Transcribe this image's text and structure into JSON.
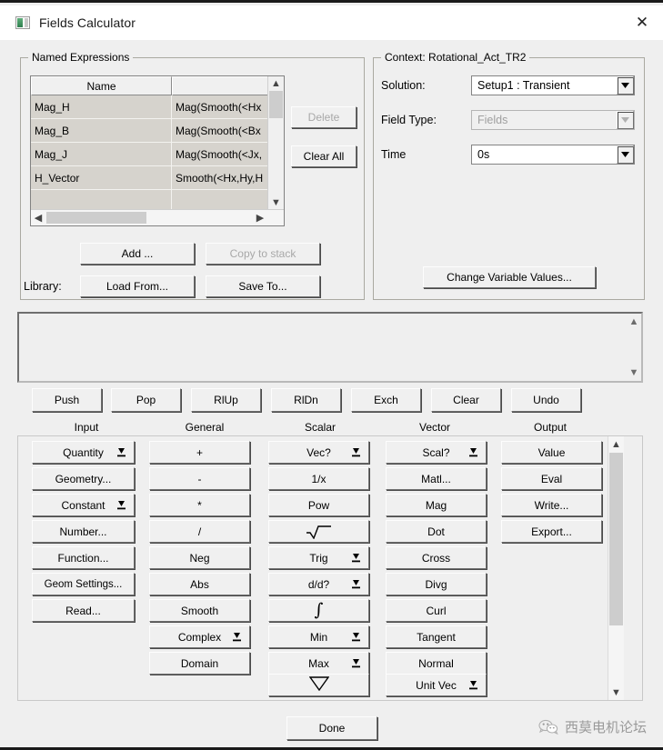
{
  "window": {
    "title": "Fields Calculator",
    "icon": "fields-calculator-icon",
    "close_label": "✕"
  },
  "named_expressions": {
    "legend": "Named Expressions",
    "columns": [
      "Name",
      ""
    ],
    "rows": [
      {
        "name": "Mag_H",
        "expression": "Mag(Smooth(<Hx"
      },
      {
        "name": "Mag_B",
        "expression": "Mag(Smooth(<Bx"
      },
      {
        "name": "Mag_J",
        "expression": "Mag(Smooth(<Jx,"
      },
      {
        "name": "H_Vector",
        "expression": "Smooth(<Hx,Hy,H"
      },
      {
        "name": "",
        "expression": ""
      }
    ],
    "delete_label": "Delete",
    "delete_disabled": true,
    "clear_all_label": "Clear All",
    "add_label": "Add ...",
    "copy_to_stack_label": "Copy to stack",
    "copy_to_stack_disabled": true,
    "library_label": "Library:",
    "load_from_label": "Load From...",
    "save_to_label": "Save To..."
  },
  "context": {
    "legend": "Context: Rotational_Act_TR2",
    "solution_label": "Solution:",
    "solution_value": "Setup1 : Transient",
    "field_type_label": "Field Type:",
    "field_type_value": "Fields",
    "field_type_disabled": true,
    "time_label": "Time",
    "time_value": "0s",
    "change_variable_values_label": "Change Variable Values..."
  },
  "stack": {
    "content": "",
    "buttons": [
      "Push",
      "Pop",
      "RlUp",
      "RlDn",
      "Exch",
      "Clear",
      "Undo"
    ]
  },
  "operations": {
    "headers": [
      "Input",
      "General",
      "Scalar",
      "Vector",
      "Output"
    ],
    "columns": [
      {
        "header": "Input",
        "buttons": [
          {
            "label": "Quantity",
            "dropdown": true
          },
          {
            "label": "Geometry...",
            "dropdown": false
          },
          {
            "label": "Constant",
            "dropdown": true
          },
          {
            "label": "Number...",
            "dropdown": false
          },
          {
            "label": "Function...",
            "dropdown": false
          },
          {
            "label": "Geom Settings...",
            "dropdown": false
          },
          {
            "label": "Read...",
            "dropdown": false
          }
        ]
      },
      {
        "header": "General",
        "buttons": [
          {
            "label": "+",
            "dropdown": false
          },
          {
            "label": "-",
            "dropdown": false
          },
          {
            "label": "*",
            "dropdown": false
          },
          {
            "label": "/",
            "dropdown": false
          },
          {
            "label": "Neg",
            "dropdown": false
          },
          {
            "label": "Abs",
            "dropdown": false
          },
          {
            "label": "Smooth",
            "dropdown": false
          },
          {
            "label": "Complex",
            "dropdown": true
          },
          {
            "label": "Domain",
            "dropdown": false
          }
        ]
      },
      {
        "header": "Scalar",
        "buttons": [
          {
            "label": "Vec?",
            "dropdown": true
          },
          {
            "label": "1/x",
            "dropdown": false
          },
          {
            "label": "Pow",
            "dropdown": false
          },
          {
            "label": "√",
            "dropdown": false,
            "glyph": "sqrt"
          },
          {
            "label": "Trig",
            "dropdown": true
          },
          {
            "label": "d/d?",
            "dropdown": true
          },
          {
            "label": "∫",
            "dropdown": false,
            "glyph": "integral"
          },
          {
            "label": "Min",
            "dropdown": true
          },
          {
            "label": "Max",
            "dropdown": true
          },
          {
            "label": "∇",
            "dropdown": false,
            "glyph": "nabla"
          }
        ]
      },
      {
        "header": "Vector",
        "buttons": [
          {
            "label": "Scal?",
            "dropdown": true
          },
          {
            "label": "Matl...",
            "dropdown": false
          },
          {
            "label": "Mag",
            "dropdown": false
          },
          {
            "label": "Dot",
            "dropdown": false
          },
          {
            "label": "Cross",
            "dropdown": false
          },
          {
            "label": "Divg",
            "dropdown": false
          },
          {
            "label": "Curl",
            "dropdown": false
          },
          {
            "label": "Tangent",
            "dropdown": false
          },
          {
            "label": "Normal",
            "dropdown": false
          },
          {
            "label": "Unit Vec",
            "dropdown": true
          }
        ]
      },
      {
        "header": "Output",
        "buttons": [
          {
            "label": "Value",
            "dropdown": false
          },
          {
            "label": "Eval",
            "dropdown": false
          },
          {
            "label": "Write...",
            "dropdown": false
          },
          {
            "label": "Export...",
            "dropdown": false
          }
        ]
      }
    ]
  },
  "footer": {
    "done_label": "Done",
    "watermark_text": "西莫电机论坛",
    "watermark_icon": "wechat-icon"
  }
}
